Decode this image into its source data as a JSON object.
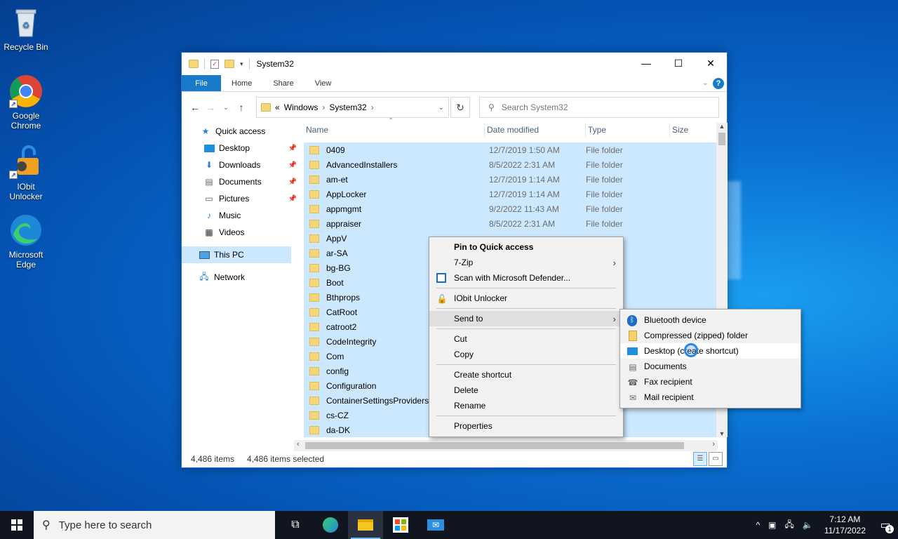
{
  "desktop": {
    "icons": [
      {
        "label": "Recycle Bin"
      },
      {
        "label": "Google Chrome"
      },
      {
        "label": "IObit Unlocker"
      },
      {
        "label": "Microsoft Edge"
      }
    ]
  },
  "explorer": {
    "title": "System32",
    "ribbon_tabs": [
      "File",
      "Home",
      "Share",
      "View"
    ],
    "address": {
      "overflow": "«",
      "crumbs": [
        "Windows",
        "System32"
      ]
    },
    "search_placeholder": "Search System32",
    "nav": {
      "quick_access": "Quick access",
      "items": [
        "Desktop",
        "Downloads",
        "Documents",
        "Pictures",
        "Music",
        "Videos"
      ],
      "this_pc": "This PC",
      "network": "Network"
    },
    "columns": {
      "name": "Name",
      "date": "Date modified",
      "type": "Type",
      "size": "Size"
    },
    "rows": [
      {
        "name": "0409",
        "date": "12/7/2019 1:50 AM",
        "type": "File folder"
      },
      {
        "name": "AdvancedInstallers",
        "date": "8/5/2022 2:31 AM",
        "type": "File folder"
      },
      {
        "name": "am-et",
        "date": "12/7/2019 1:14 AM",
        "type": "File folder"
      },
      {
        "name": "AppLocker",
        "date": "12/7/2019 1:14 AM",
        "type": "File folder"
      },
      {
        "name": "appmgmt",
        "date": "9/2/2022 11:43 AM",
        "type": "File folder"
      },
      {
        "name": "appraiser",
        "date": "8/5/2022 2:31 AM",
        "type": "File folder"
      },
      {
        "name": "AppV",
        "date": "",
        "type": ""
      },
      {
        "name": "ar-SA",
        "date": "",
        "type": ""
      },
      {
        "name": "bg-BG",
        "date": "",
        "type": ""
      },
      {
        "name": "Boot",
        "date": "",
        "type": ""
      },
      {
        "name": "Bthprops",
        "date": "",
        "type": ""
      },
      {
        "name": "CatRoot",
        "date": "",
        "type": ""
      },
      {
        "name": "catroot2",
        "date": "",
        "type": ""
      },
      {
        "name": "CodeIntegrity",
        "date": "",
        "type": ""
      },
      {
        "name": "Com",
        "date": "",
        "type": ""
      },
      {
        "name": "config",
        "date": "",
        "type": ""
      },
      {
        "name": "Configuration",
        "date": "",
        "type": ""
      },
      {
        "name": "ContainerSettingsProviders",
        "date": "",
        "type": ""
      },
      {
        "name": "cs-CZ",
        "date": "",
        "type": ""
      },
      {
        "name": "da-DK",
        "date": "",
        "type": ""
      }
    ],
    "status": {
      "count": "4,486 items",
      "selected": "4,486 items selected"
    }
  },
  "context_menu": {
    "items": [
      {
        "label": "Pin to Quick access",
        "icon": "",
        "bold": true
      },
      {
        "label": "7-Zip",
        "icon": "",
        "submenu": true
      },
      {
        "label": "Scan with Microsoft Defender...",
        "icon": "defender-icon"
      },
      {
        "label": "IObit Unlocker",
        "icon": "unlocker-icon"
      },
      {
        "label": "Send to",
        "icon": "",
        "submenu": true
      },
      {
        "label": "Cut",
        "icon": ""
      },
      {
        "label": "Copy",
        "icon": ""
      },
      {
        "label": "Create shortcut",
        "icon": ""
      },
      {
        "label": "Delete",
        "icon": "shield-icon"
      },
      {
        "label": "Rename",
        "icon": "shield-icon"
      },
      {
        "label": "Properties",
        "icon": ""
      }
    ]
  },
  "send_to_menu": {
    "items": [
      {
        "label": "Bluetooth device",
        "icon": "bluetooth-icon"
      },
      {
        "label": "Compressed (zipped) folder",
        "icon": "zip-folder-icon"
      },
      {
        "label": "Desktop (create shortcut)",
        "icon": "desktop-icon"
      },
      {
        "label": "Documents",
        "icon": "documents-icon"
      },
      {
        "label": "Fax recipient",
        "icon": "fax-icon"
      },
      {
        "label": "Mail recipient",
        "icon": "mail-icon"
      }
    ]
  },
  "taskbar": {
    "search_placeholder": "Type here to search",
    "time": "7:12 AM",
    "date": "11/17/2022",
    "notification_count": "1"
  },
  "colors": {
    "accent": "#1979ca",
    "selection": "#cce8ff"
  }
}
